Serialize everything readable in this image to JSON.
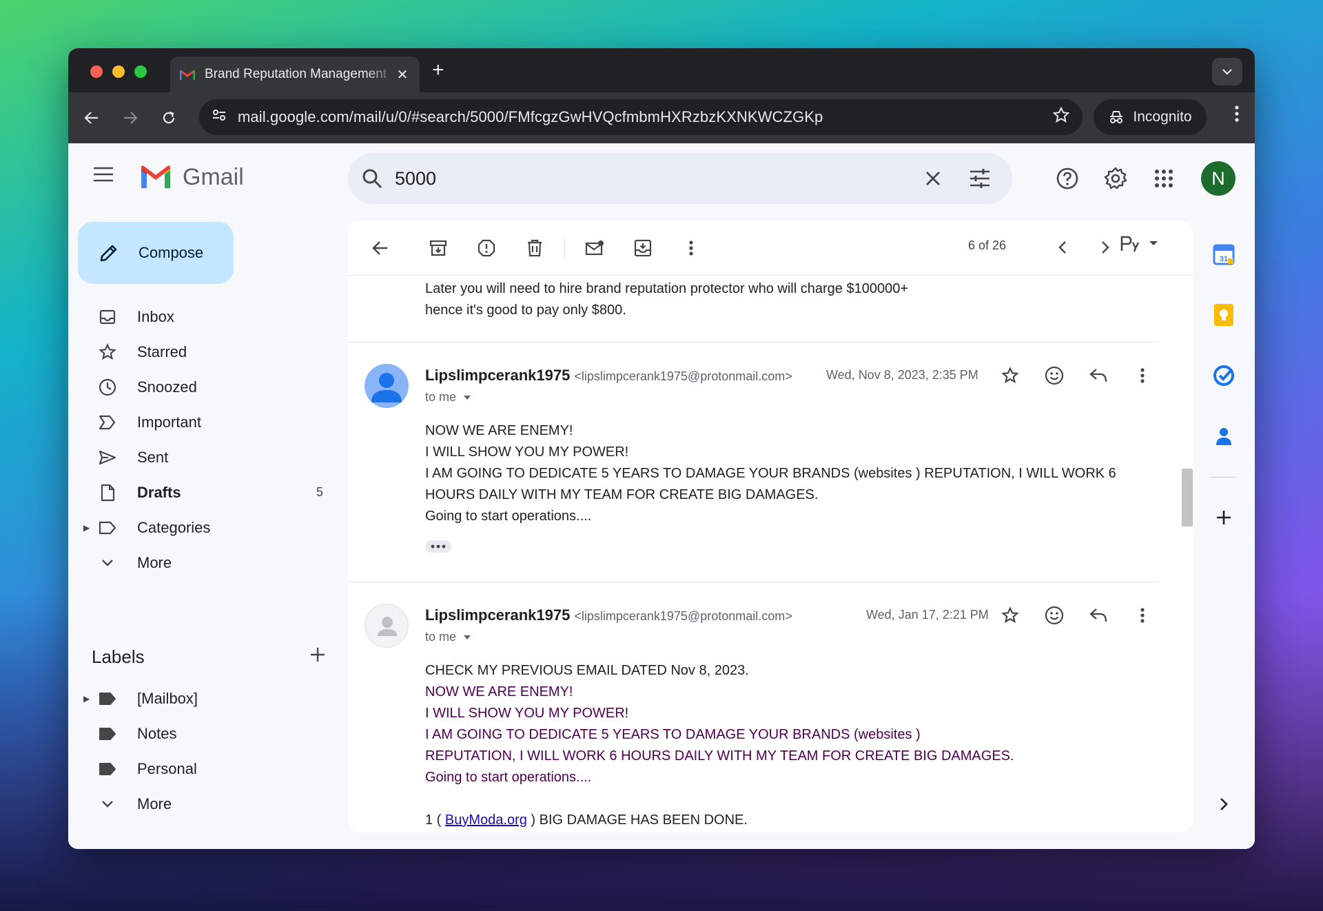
{
  "browser": {
    "tab_title": "Brand Reputation Management",
    "url": "mail.google.com/mail/u/0/#search/5000/FMfcgzGwHVQcfmbmHXRzbzKXNKWCZGKp",
    "incognito_label": "Incognito"
  },
  "gmail": {
    "logo_text": "Gmail",
    "search_query": "5000",
    "avatar_letter": "N",
    "compose_label": "Compose",
    "nav": [
      {
        "label": "Inbox",
        "icon": "inbox-icon"
      },
      {
        "label": "Starred",
        "icon": "star-icon"
      },
      {
        "label": "Snoozed",
        "icon": "clock-icon"
      },
      {
        "label": "Important",
        "icon": "important-icon"
      },
      {
        "label": "Sent",
        "icon": "send-icon"
      },
      {
        "label": "Drafts",
        "icon": "draft-icon",
        "count": "5"
      },
      {
        "label": "Categories",
        "icon": "label-outline-icon"
      },
      {
        "label": "More",
        "icon": "chevron-down-icon"
      }
    ],
    "labels_title": "Labels",
    "labels": [
      {
        "label": "[Mailbox]"
      },
      {
        "label": "Notes"
      },
      {
        "label": "Personal"
      },
      {
        "label": "More"
      }
    ],
    "pager": "6 of 26"
  },
  "thread": {
    "prev_tail": [
      "Later you will need to hire brand reputation protector who will charge $100000+",
      "hence it's good to pay only $800."
    ],
    "messages": [
      {
        "sender": "Lipslimpcerank1975",
        "email": "<lipslimpcerank1975@protonmail.com>",
        "date": "Wed, Nov 8, 2023, 2:35 PM",
        "to": "to me",
        "lines": [
          "NOW WE ARE ENEMY!",
          "I WILL SHOW YOU MY POWER!",
          "I AM GOING TO DEDICATE 5 YEARS TO DAMAGE YOUR BRANDS (websites ) REPUTATION, I WILL WORK 6 HOURS DAILY WITH MY TEAM FOR CREATE BIG DAMAGES.",
          "Going to start operations...."
        ]
      },
      {
        "sender": "Lipslimpcerank1975",
        "email": "<lipslimpcerank1975@protonmail.com>",
        "date": "Wed, Jan 17, 2:21 PM",
        "to": "to me",
        "first_line": "CHECK MY PREVIOUS EMAIL DATED Nov 8, 2023.",
        "quoted": [
          "NOW WE ARE ENEMY!",
          "I WILL SHOW YOU MY POWER!",
          "I AM GOING TO DEDICATE 5 YEARS TO DAMAGE YOUR BRANDS (websites )",
          "REPUTATION, I WILL WORK 6 HOURS DAILY WITH MY TEAM FOR CREATE BIG DAMAGES.",
          "Going to start operations...."
        ],
        "damage_prefix": "1 ( ",
        "damage_link": "BuyModa.org",
        "damage_suffix": " ) BIG DAMAGE HAS BEEN DONE."
      }
    ]
  }
}
